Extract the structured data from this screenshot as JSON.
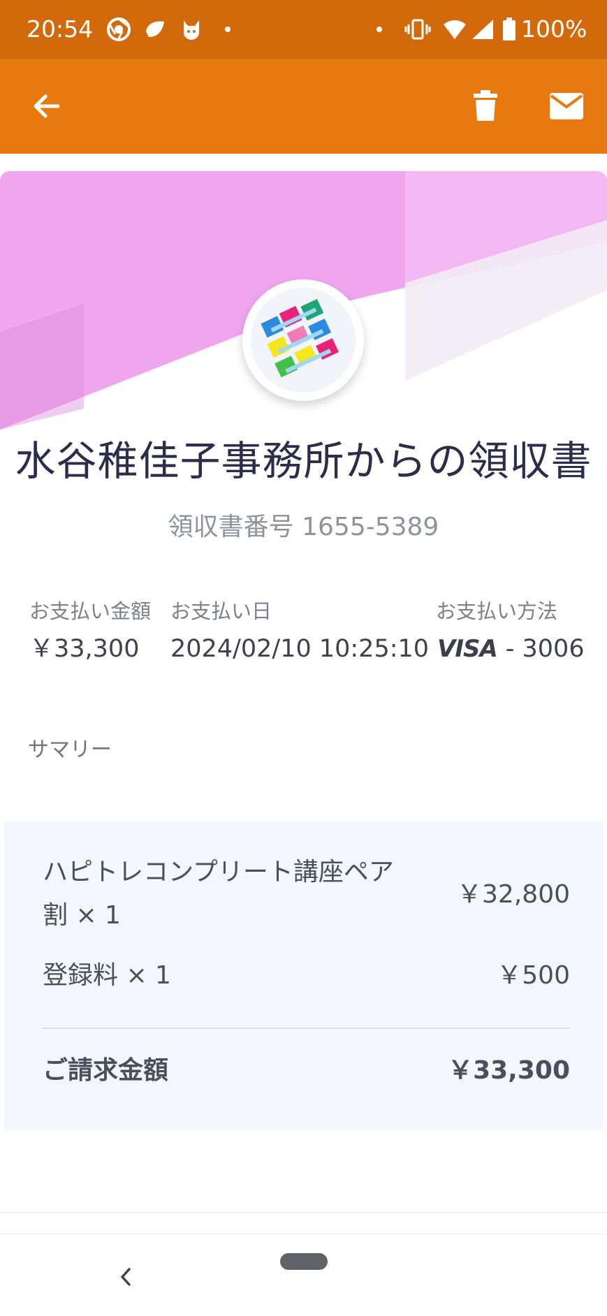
{
  "status_bar": {
    "time": "20:54",
    "battery": "100%",
    "left_icons": [
      "chrome-icon",
      "leaf-icon",
      "fox-icon",
      "dot-icon"
    ],
    "right_icons": [
      "dot-icon",
      "vibrate-icon",
      "wifi-icon",
      "signal-icon",
      "battery-icon"
    ]
  },
  "colors": {
    "status_bar": "#d2690a",
    "app_bar": "#e8790f",
    "hero_pink": "#f0a6ef",
    "title": "#2c2d4a",
    "summary_bg": "#f3f6fb"
  },
  "app_bar": {
    "back_icon": "arrow-back-icon",
    "delete_icon": "trash-icon",
    "mail_icon": "mail-icon"
  },
  "receipt": {
    "title": "水谷稚佳子事務所からの領収書",
    "number": "領収書番号 1655-5389",
    "amount_label": "お支払い金額",
    "amount_value": "￥33,300",
    "date_label": "お支払い日",
    "date_value": "2024/02/10 10:25:10",
    "method_label": "お支払い方法",
    "method_brand": "VISA",
    "method_value": "- 3006"
  },
  "summary": {
    "heading": "サマリー",
    "items": [
      {
        "name_line1": "ハピトレコンプリート講座ペア",
        "name_line2": "割 × 1",
        "amount": "￥32,800"
      },
      {
        "name_line1": "登録料 × 1",
        "amount": "￥500"
      }
    ],
    "total_label": "ご請求金額",
    "total_amount": "￥33,300"
  },
  "nav_bar": {
    "back_icon": "chevron-left-icon",
    "home_icon": "home-pill-icon"
  }
}
